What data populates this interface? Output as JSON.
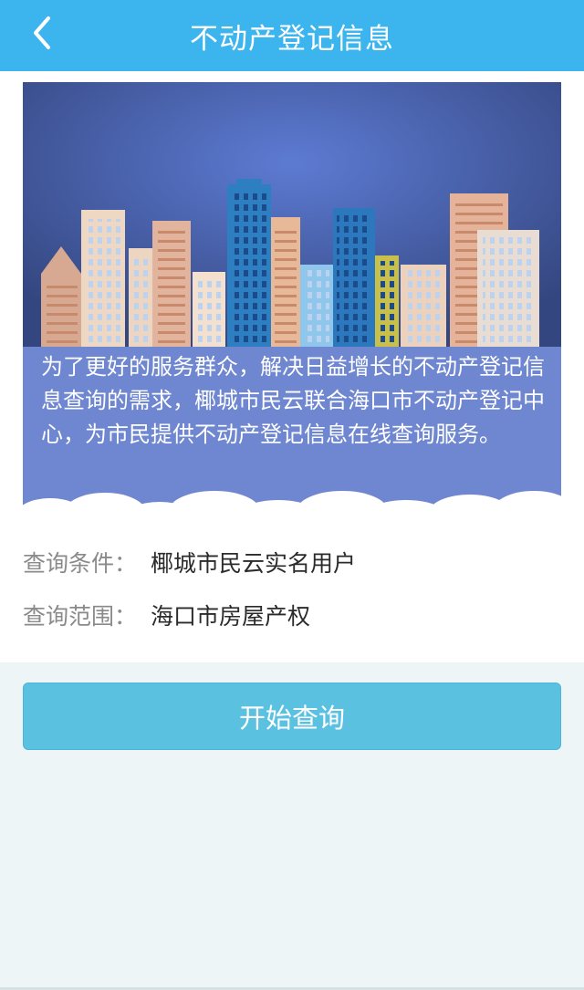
{
  "header": {
    "title": "不动产登记信息",
    "back_icon": "chevron-left-icon"
  },
  "banner": {
    "description": "为了更好的服务群众，解决日益增长的不动产登记信息查询的需求，椰城市民云联合海口市不动产登记中心，为市民提供不动产登记信息在线查询服务。"
  },
  "info": {
    "condition_label": "查询条件：",
    "condition_value": "椰城市民云实名用户",
    "scope_label": "查询范围：",
    "scope_value": "海口市房屋产权"
  },
  "actions": {
    "start_label": "开始查询"
  },
  "colors": {
    "header": "#3cb4ee",
    "button": "#5bc1e1",
    "banner_sky_top": "#3a4f8f",
    "banner_text_band": "#6f86d0",
    "background": "#eef5f6"
  }
}
